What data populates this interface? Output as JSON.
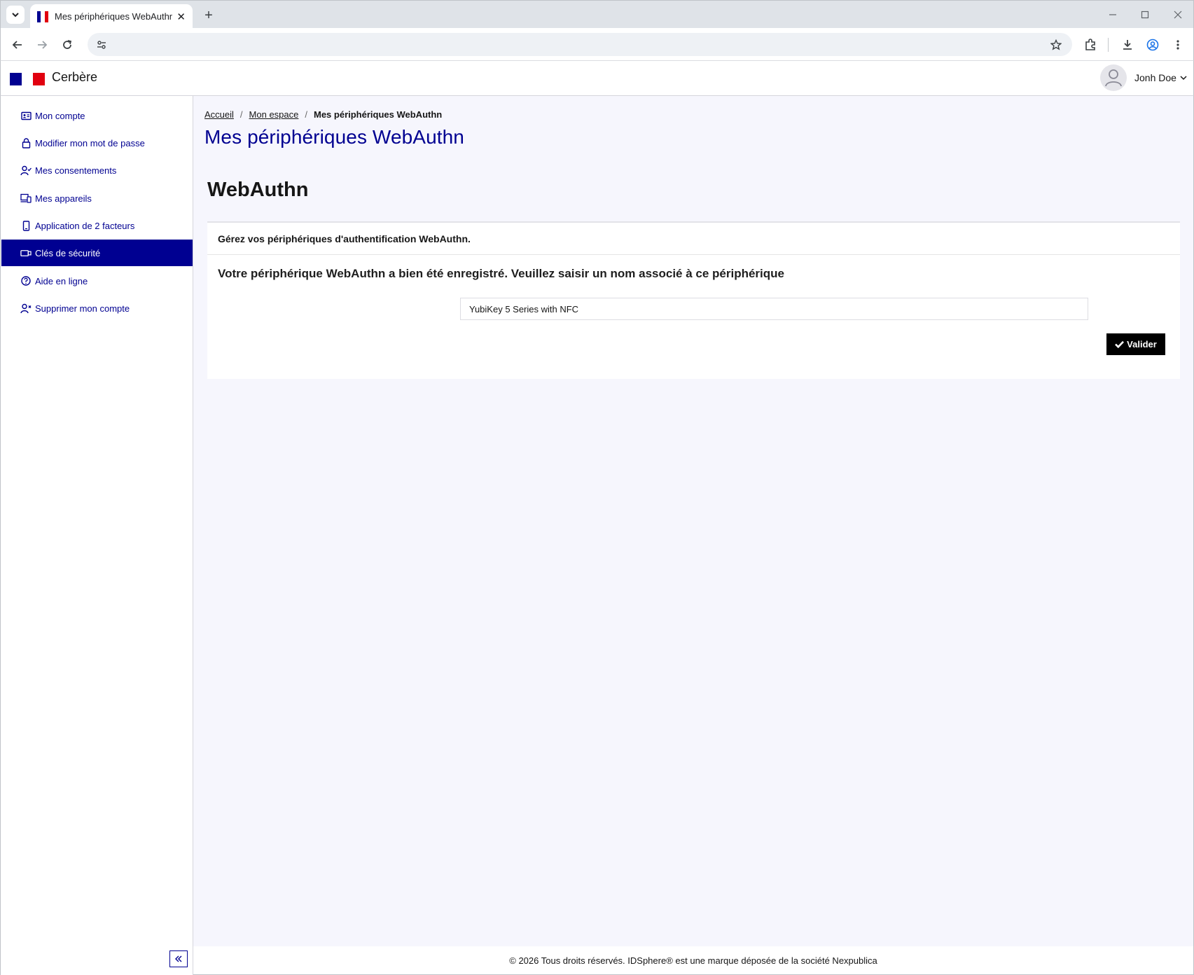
{
  "browser": {
    "tab_title": "Mes périphériques WebAuthn",
    "new_tab": "+",
    "close_tab": "✕"
  },
  "header": {
    "brand": "Cerbère",
    "user_name": "Jonh Doe"
  },
  "sidebar": {
    "items": [
      {
        "label": "Mon compte",
        "icon": "id-card-icon"
      },
      {
        "label": "Modifier mon mot de passe",
        "icon": "lock-icon"
      },
      {
        "label": "Mes consentements",
        "icon": "user-check-icon"
      },
      {
        "label": "Mes appareils",
        "icon": "devices-icon"
      },
      {
        "label": "Application de 2 facteurs",
        "icon": "smartphone-icon"
      },
      {
        "label": "Clés de sécurité",
        "icon": "security-key-icon"
      },
      {
        "label": "Aide en ligne",
        "icon": "help-circle-icon"
      },
      {
        "label": "Supprimer mon compte",
        "icon": "user-remove-icon"
      }
    ],
    "active_index": 5
  },
  "breadcrumb": {
    "home": "Accueil",
    "space": "Mon espace",
    "current": "Mes périphériques WebAuthn"
  },
  "page": {
    "title": "Mes périphériques WebAuthn",
    "section_title": "WebAuthn"
  },
  "card": {
    "header": "Gérez vos périphériques d'authentification WebAuthn.",
    "message": "Votre périphérique WebAuthn a bien été enregistré. Veuillez saisir un nom associé à ce périphérique",
    "device_name_value": "YubiKey 5 Series with NFC",
    "validate_label": "Valider"
  },
  "footer": {
    "text": "© 2026 Tous droits réservés. IDSphere® est une marque déposée de la société Nexpublica"
  },
  "colors": {
    "primary": "#000091",
    "main_bg": "#f6f6fd",
    "flag_blue": "#000091",
    "flag_red": "#e1000f"
  }
}
